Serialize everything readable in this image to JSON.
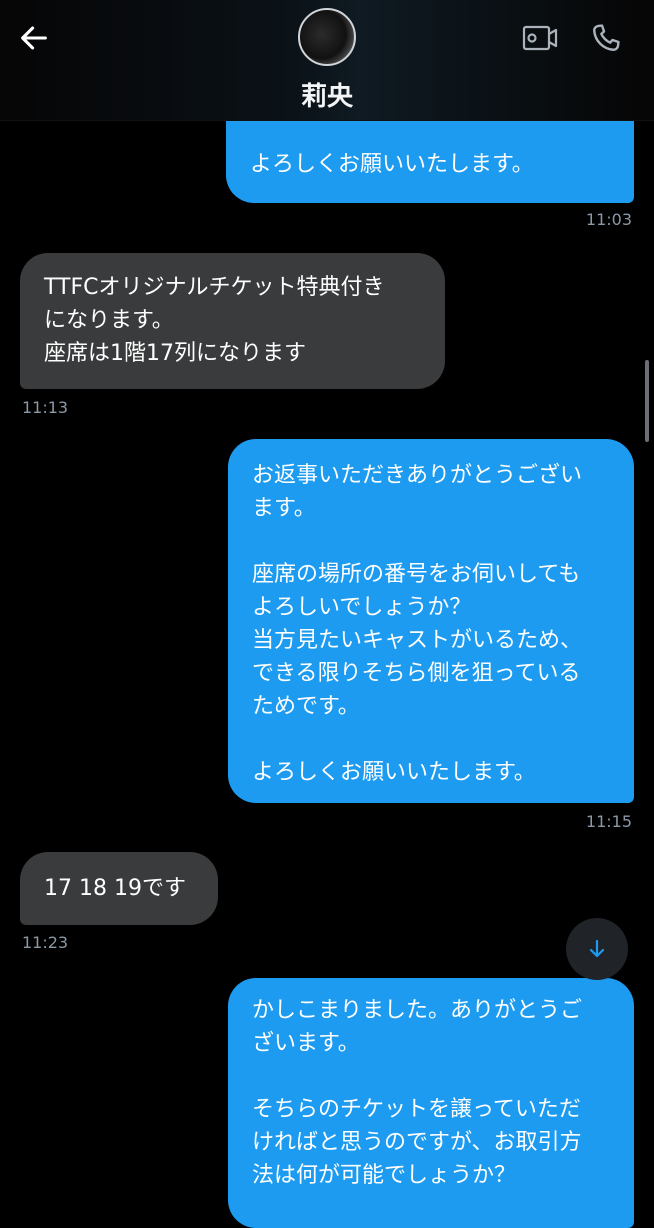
{
  "header": {
    "contact_name": "莉央",
    "back_icon": "arrow-left-icon",
    "video_icon": "video-camera-icon",
    "call_icon": "phone-icon"
  },
  "messages": [
    {
      "direction": "sent",
      "text": "よろしくお願いいたします。",
      "time": "11:03"
    },
    {
      "direction": "received",
      "text": "TTFCオリジナルチケット特典付き\nになります。\n座席は1階17列になります",
      "time": "11:13"
    },
    {
      "direction": "sent",
      "text": "お返事いただきありがとうござい\nます。\n\n座席の場所の番号をお伺いしても\nよろしいでしょうか？\n当方見たいキャストがいるため、\nできる限りそちら側を狙っている\nためです。\n\nよろしくお願いいたします。",
      "time": "11:15"
    },
    {
      "direction": "received",
      "text": "17 18 19です",
      "time": "11:23"
    },
    {
      "direction": "sent",
      "text": "かしこまりました。ありがとうご\nざいます。\n\nそちらのチケットを譲っていただ\nければと思うのですが、お取引方\n法は何が可能でしょうか？",
      "time": ""
    }
  ],
  "jump_to_bottom_icon": "arrow-down-icon",
  "colors": {
    "sent_bubble": "#1d9bf0",
    "received_bubble": "#3a3b3c",
    "background": "#000000",
    "timestamp": "#8b98a5"
  }
}
